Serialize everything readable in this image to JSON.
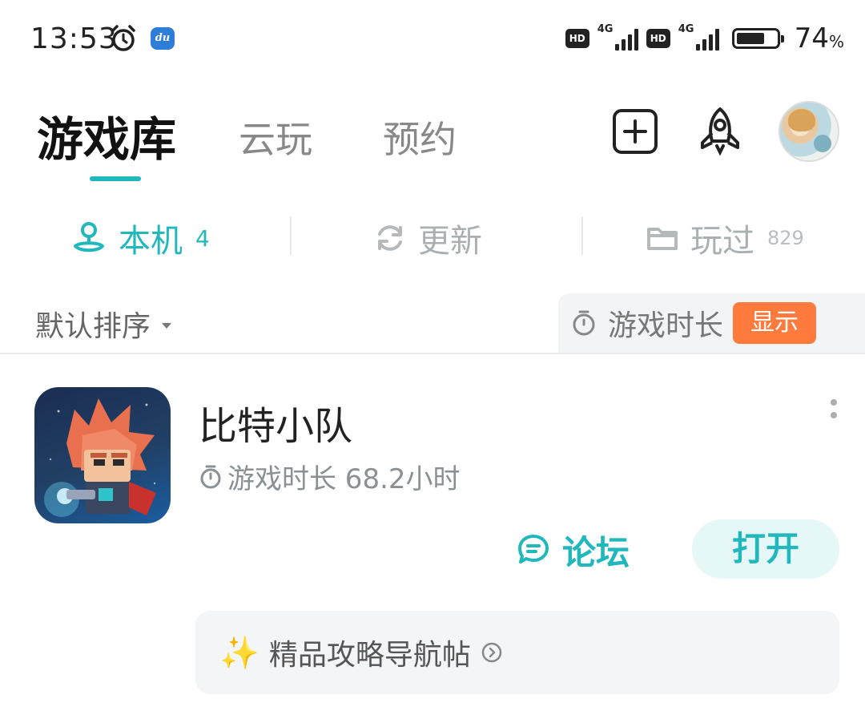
{
  "status_bar": {
    "time": "13:53",
    "hd_badge": "HD",
    "network_1": "4G",
    "network_2": "4G",
    "battery_percent": "74",
    "battery_unit": "%",
    "battery_level": 0.74
  },
  "top_tabs": [
    {
      "label": "游戏库",
      "active": true
    },
    {
      "label": "云玩",
      "active": false
    },
    {
      "label": "预约",
      "active": false
    }
  ],
  "header_actions": {
    "add_icon": "plus-square-icon",
    "rocket_icon": "rocket-icon",
    "avatar": "user-avatar"
  },
  "sub_tabs": [
    {
      "label": "本机",
      "count": "4",
      "active": true,
      "icon": "joystick-icon"
    },
    {
      "label": "更新",
      "count": "",
      "active": false,
      "icon": "refresh-icon"
    },
    {
      "label": "玩过",
      "count": "829",
      "active": false,
      "icon": "folder-icon"
    }
  ],
  "sort": {
    "label": "默认排序"
  },
  "playtime_toggle": {
    "label": "游戏时长",
    "badge": "显示",
    "badge_color": "#ff7a3d"
  },
  "game": {
    "title": "比特小队",
    "playtime": "游戏时长 68.2小时",
    "forum_label": "论坛",
    "open_label": "打开"
  },
  "guide": {
    "emoji": "✨",
    "label": "精品攻略导航帖"
  },
  "colors": {
    "accent": "#21b8bd",
    "text_primary": "#222222",
    "text_secondary": "#8a9093"
  }
}
